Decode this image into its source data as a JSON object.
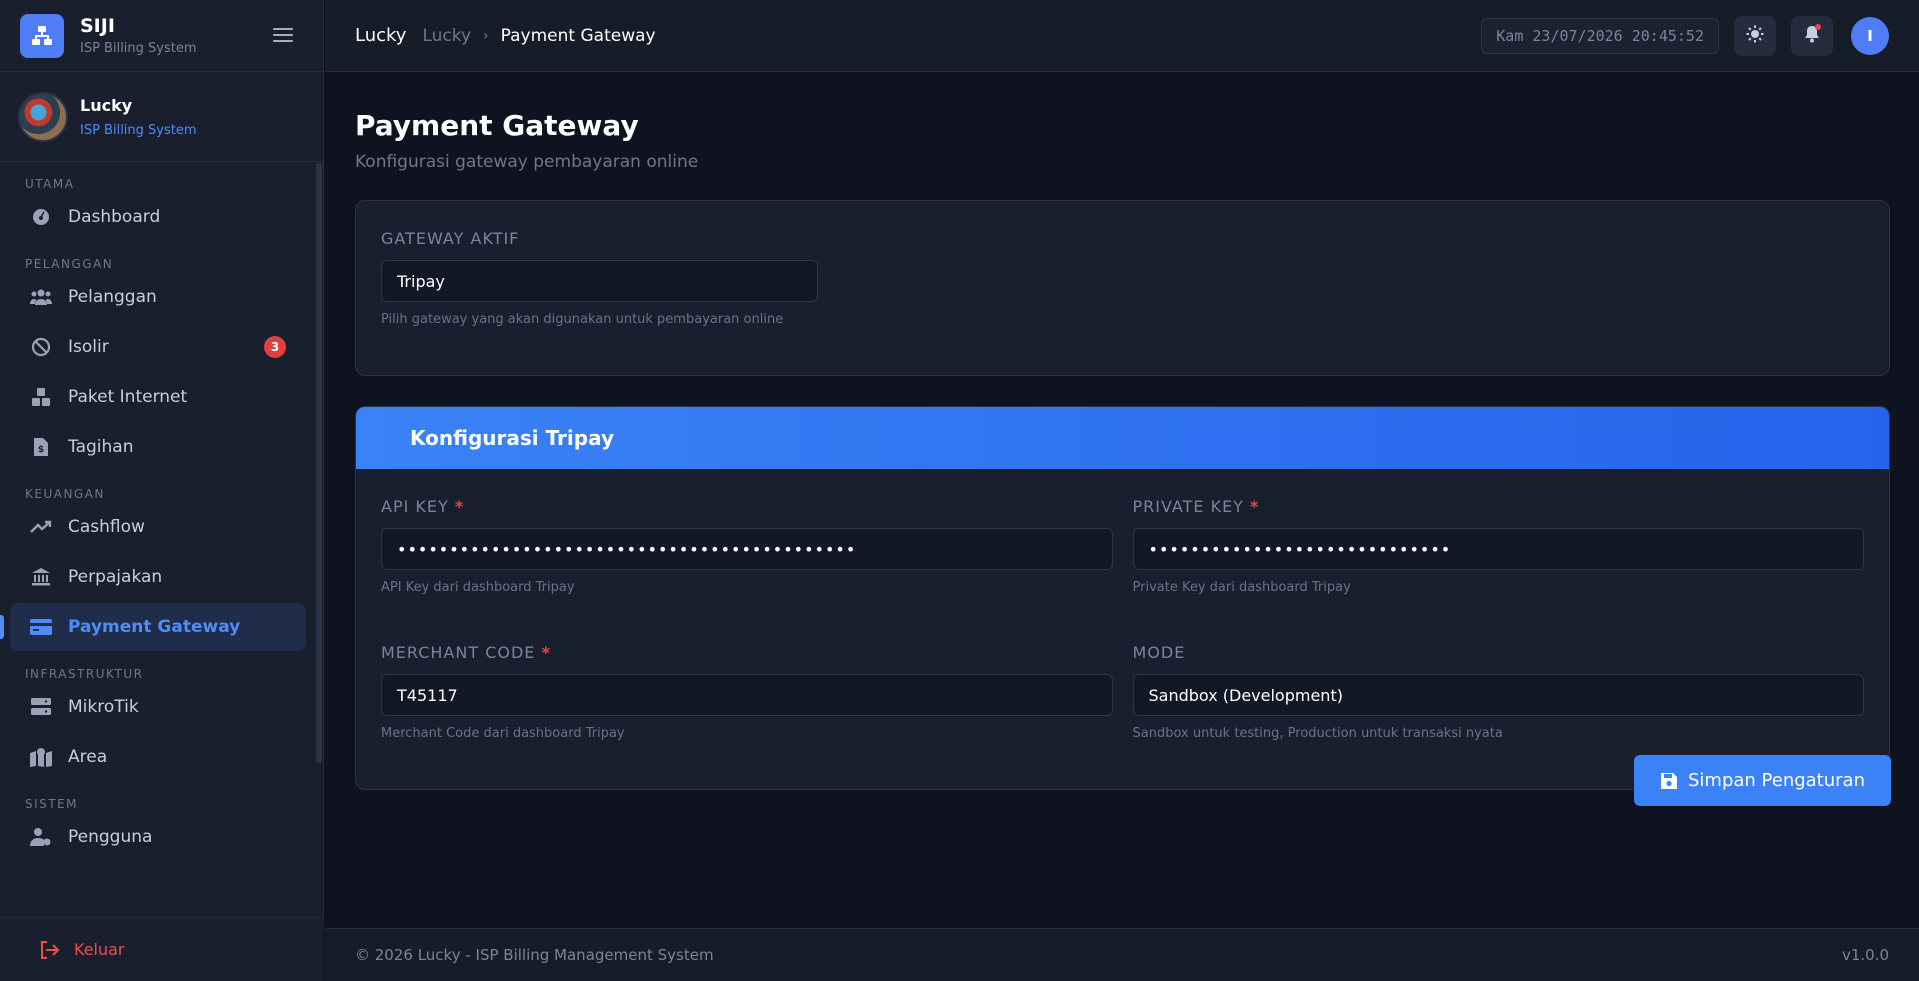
{
  "brand": {
    "name": "SIJI",
    "subtitle": "ISP Billing System"
  },
  "profile": {
    "name": "Lucky",
    "role": "ISP Billing System"
  },
  "sidebar": {
    "sections": [
      {
        "title": "UTAMA"
      },
      {
        "title": "PELANGGAN"
      },
      {
        "title": "KEUANGAN"
      },
      {
        "title": "INFRASTRUKTUR"
      },
      {
        "title": "SISTEM"
      }
    ],
    "items": [
      {
        "label": "Dashboard",
        "icon": "dashboard-icon"
      },
      {
        "label": "Pelanggan",
        "icon": "users-icon"
      },
      {
        "label": "Isolir",
        "icon": "ban-icon",
        "badge": "3"
      },
      {
        "label": "Paket Internet",
        "icon": "boxes-icon"
      },
      {
        "label": "Tagihan",
        "icon": "invoice-icon"
      },
      {
        "label": "Cashflow",
        "icon": "trend-up-icon"
      },
      {
        "label": "Perpajakan",
        "icon": "bank-icon"
      },
      {
        "label": "Payment Gateway",
        "icon": "credit-card-icon",
        "active": true
      },
      {
        "label": "MikroTik",
        "icon": "server-icon"
      },
      {
        "label": "Area",
        "icon": "map-icon"
      },
      {
        "label": "Pengguna",
        "icon": "user-gear-icon"
      }
    ],
    "logout_label": "Keluar"
  },
  "header": {
    "breadcrumb_app": "Lucky",
    "breadcrumb_parent": "Lucky",
    "breadcrumb_current": "Payment Gateway",
    "clock": "Kam 23/07/2026 20:45:52",
    "avatar_initial": "I"
  },
  "page": {
    "title": "Payment Gateway",
    "subtitle": "Konfigurasi gateway pembayaran online"
  },
  "gateway": {
    "label": "GATEWAY AKTIF",
    "value": "Tripay",
    "hint": "Pilih gateway yang akan digunakan untuk pembayaran online"
  },
  "config": {
    "title": "Konfigurasi Tripay",
    "api_key": {
      "label": "API KEY",
      "value": "••••••••••••••••••••••••••••••••••••••••••••",
      "hint": "API Key dari dashboard Tripay"
    },
    "private_key": {
      "label": "PRIVATE KEY",
      "value": "•••••••••••••••••••••••••••••",
      "hint": "Private Key dari dashboard Tripay"
    },
    "merchant_code": {
      "label": "MERCHANT CODE",
      "value": "T45117",
      "hint": "Merchant Code dari dashboard Tripay"
    },
    "mode": {
      "label": "MODE",
      "value": "Sandbox (Development)",
      "hint": "Sandbox untuk testing, Production untuk transaksi nyata"
    },
    "required_mark": "*"
  },
  "actions": {
    "save_label": "Simpan Pengaturan"
  },
  "footer": {
    "copyright": "© 2026 Lucky - ISP Billing Management System",
    "version": "v1.0.0"
  },
  "colors": {
    "accent": "#3b82f6",
    "danger": "#ef4444",
    "background": "#0f1320",
    "card": "#1a1f30"
  }
}
